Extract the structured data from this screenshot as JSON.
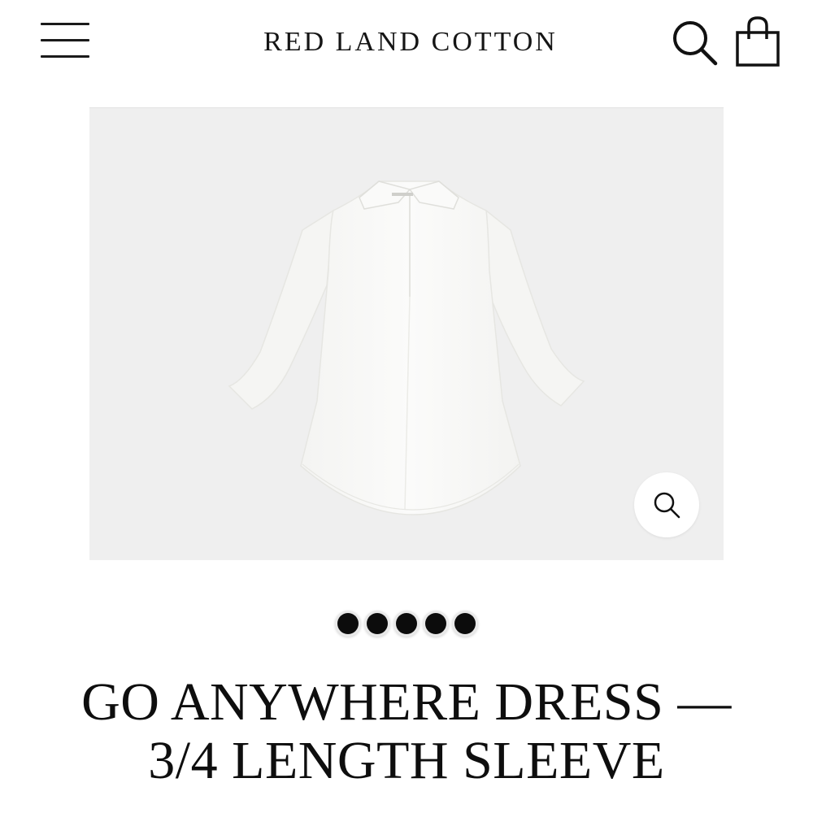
{
  "header": {
    "brand": "RED LAND COTTON",
    "menu_icon": "hamburger-menu-icon",
    "search_icon": "search-icon",
    "cart_icon": "shopping-bag-icon"
  },
  "gallery": {
    "image_subject": "white collared dress with 3/4 length sleeves",
    "zoom_icon": "zoom-magnifier-icon",
    "slide_count": 5,
    "active_slide": 1
  },
  "product": {
    "title_line1": "GO ANYWHERE DRESS —",
    "title_line2": "3/4 LENGTH SLEEVE"
  },
  "colors": {
    "text": "#111111",
    "gallery_background": "#efefef",
    "dot": "#0c0c0c"
  }
}
